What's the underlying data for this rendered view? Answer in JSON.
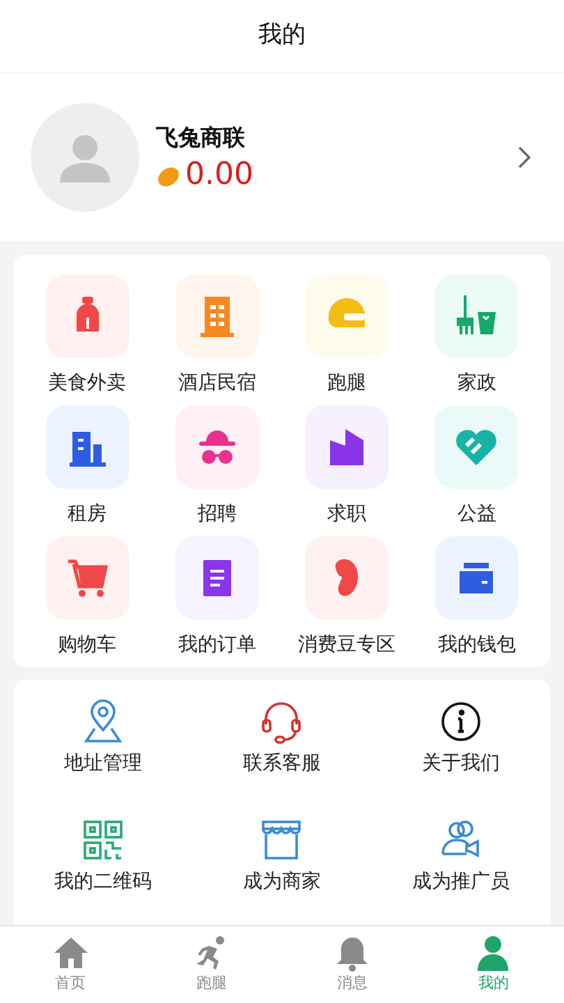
{
  "header": {
    "title": "我的"
  },
  "profile": {
    "name": "飞兔商联",
    "balance": "0.00"
  },
  "services": [
    {
      "label": "美食外卖"
    },
    {
      "label": "酒店民宿"
    },
    {
      "label": "跑腿"
    },
    {
      "label": "家政"
    },
    {
      "label": "租房"
    },
    {
      "label": "招聘"
    },
    {
      "label": "求职"
    },
    {
      "label": "公益"
    },
    {
      "label": "购物车"
    },
    {
      "label": "我的订单"
    },
    {
      "label": "消费豆专区"
    },
    {
      "label": "我的钱包"
    }
  ],
  "tools": [
    {
      "label": "地址管理"
    },
    {
      "label": "联系客服"
    },
    {
      "label": "关于我们"
    },
    {
      "label": "我的二维码"
    },
    {
      "label": "成为商家"
    },
    {
      "label": "成为推广员"
    }
  ],
  "tabs": [
    {
      "label": "首页",
      "selected": false
    },
    {
      "label": "跑腿",
      "selected": false
    },
    {
      "label": "消息",
      "selected": false
    },
    {
      "label": "我的",
      "selected": true
    }
  ]
}
